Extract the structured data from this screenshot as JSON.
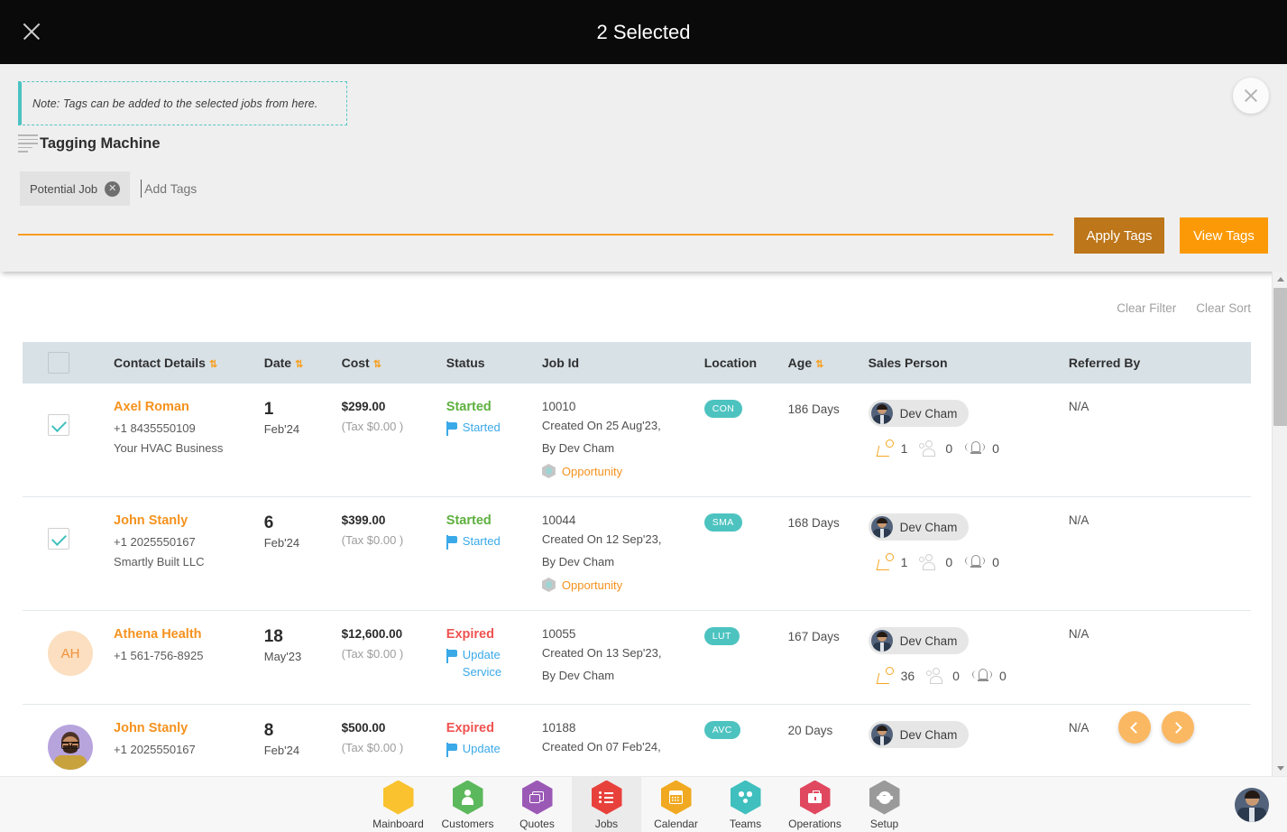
{
  "topbar": {
    "title": "2 Selected",
    "close_icon": "close-icon"
  },
  "panel": {
    "note": "Note: Tags can be added to the selected jobs from here.",
    "heading": "Tagging Machine",
    "heading_icon": "list-lines-icon",
    "close_icon": "close-icon",
    "tags": [
      {
        "label": "Potential Job",
        "remove_icon": "circle-x-icon"
      }
    ],
    "tag_input_placeholder": "Add Tags",
    "tag_input_value": "",
    "apply_button": "Apply Tags",
    "view_button": "View Tags",
    "accent_color": "#f79f1f",
    "apply_color": "#bd7619",
    "view_color": "#fb9a06"
  },
  "toolbar": {
    "clear_filter": "Clear Filter",
    "clear_sort": "Clear Sort"
  },
  "table": {
    "columns": [
      {
        "label": "",
        "sortable": false
      },
      {
        "label": "Contact Details",
        "sortable": true
      },
      {
        "label": "Date",
        "sortable": true
      },
      {
        "label": "Cost",
        "sortable": true
      },
      {
        "label": "Status",
        "sortable": false
      },
      {
        "label": "Job Id",
        "sortable": false
      },
      {
        "label": "Location",
        "sortable": false
      },
      {
        "label": "Age",
        "sortable": true
      },
      {
        "label": "Sales Person",
        "sortable": false
      },
      {
        "label": "Referred By",
        "sortable": false
      }
    ],
    "sort_icon": "sort-updown-icon",
    "rows": [
      {
        "selected": true,
        "avatar_type": "checkbox",
        "avatar_text": "",
        "name": "Axel Roman",
        "phone": "+1 8435550109",
        "company": "Your HVAC Business",
        "date_day": "1",
        "date_month": "Feb'24",
        "cost": "$299.00",
        "tax": "(Tax $0.00 )",
        "status": "Started",
        "status_kind": "started",
        "status_action": "Started",
        "job_id": "10010",
        "created_on": "Created On 25 Aug'23,",
        "created_by": "By Dev Cham",
        "opportunity": "Opportunity",
        "location": "CON",
        "age": "186 Days",
        "sales_person": "Dev Cham",
        "stat_runner": "1",
        "stat_group": "0",
        "stat_bell": "0",
        "referred_by": "N/A"
      },
      {
        "selected": true,
        "avatar_type": "checkbox",
        "avatar_text": "",
        "name": "John Stanly",
        "phone": "+1 2025550167",
        "company": "Smartly Built LLC",
        "date_day": "6",
        "date_month": "Feb'24",
        "cost": "$399.00",
        "tax": "(Tax $0.00 )",
        "status": "Started",
        "status_kind": "started",
        "status_action": "Started",
        "job_id": "10044",
        "created_on": "Created On 12 Sep'23,",
        "created_by": "By Dev Cham",
        "opportunity": "Opportunity",
        "location": "SMA",
        "age": "168 Days",
        "sales_person": "Dev Cham",
        "stat_runner": "1",
        "stat_group": "0",
        "stat_bell": "0",
        "referred_by": "N/A"
      },
      {
        "selected": false,
        "avatar_type": "initials",
        "avatar_text": "AH",
        "name": "Athena Health",
        "phone": "+1 561-756-8925",
        "company": "",
        "date_day": "18",
        "date_month": "May'23",
        "cost": "$12,600.00",
        "tax": "(Tax $0.00 )",
        "status": "Expired",
        "status_kind": "expired",
        "status_action": "Update Service",
        "job_id": "10055",
        "created_on": "Created On 13 Sep'23,",
        "created_by": "By Dev Cham",
        "opportunity": "",
        "location": "LUT",
        "age": "167 Days",
        "sales_person": "Dev Cham",
        "stat_runner": "36",
        "stat_group": "0",
        "stat_bell": "0",
        "referred_by": "N/A"
      },
      {
        "selected": false,
        "avatar_type": "photo",
        "avatar_text": "",
        "name": "John Stanly",
        "phone": "+1 2025550167",
        "company": "",
        "date_day": "8",
        "date_month": "Feb'24",
        "cost": "$500.00",
        "tax": "(Tax $0.00 )",
        "status": "Expired",
        "status_kind": "expired",
        "status_action": "Update",
        "job_id": "10188",
        "created_on": "Created On 07 Feb'24,",
        "created_by": "",
        "opportunity": "",
        "location": "AVC",
        "age": "20 Days",
        "sales_person": "Dev Cham",
        "stat_runner": "",
        "stat_group": "",
        "stat_bell": "",
        "referred_by": "N/A"
      }
    ]
  },
  "pager": {
    "prev_icon": "chevron-left-icon",
    "next_icon": "chevron-right-icon"
  },
  "scrollbar": {
    "up_icon": "triangle-up-icon",
    "down_icon": "triangle-down-icon"
  },
  "bottom_nav": {
    "items": [
      {
        "label": "Mainboard",
        "icon": "mainboard-icon",
        "color": "#f9c22e",
        "active": false
      },
      {
        "label": "Customers",
        "icon": "person-icon",
        "color": "#5cb85c",
        "active": false
      },
      {
        "label": "Quotes",
        "icon": "quotes-icon",
        "color": "#9b59b6",
        "active": false
      },
      {
        "label": "Jobs",
        "icon": "jobs-list-icon",
        "color": "#e8413c",
        "active": true
      },
      {
        "label": "Calendar",
        "icon": "calendar-icon",
        "color": "#f0a921",
        "active": false
      },
      {
        "label": "Teams",
        "icon": "teams-icon",
        "color": "#3fbfbd",
        "active": false
      },
      {
        "label": "Operations",
        "icon": "briefcase-icon",
        "color": "#e0485f",
        "active": false
      },
      {
        "label": "Setup",
        "icon": "gear-icon",
        "color": "#9a9a9a",
        "active": false
      }
    ],
    "avatar": "user-avatar"
  }
}
